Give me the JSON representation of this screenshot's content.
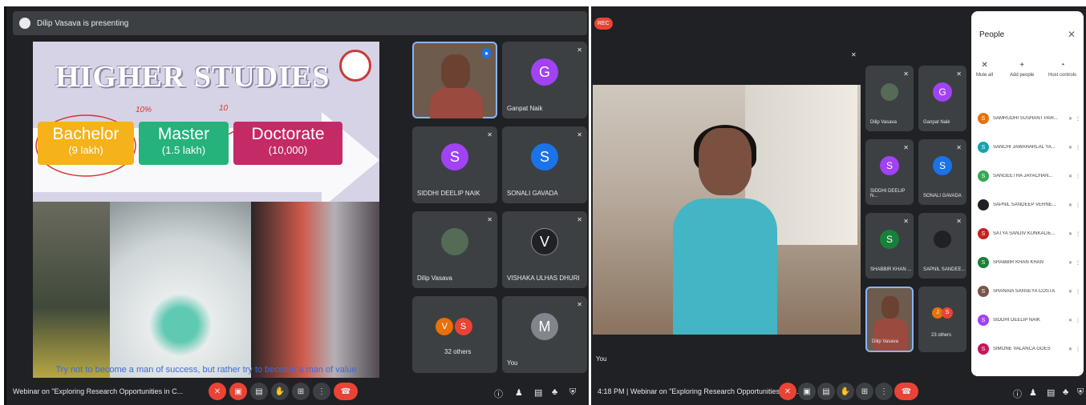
{
  "left": {
    "banner": "Dilip Vasava is presenting",
    "slide": {
      "title": "HIGHER STUDIES",
      "boxes": [
        {
          "name": "Bachelor",
          "value": "(9 lakh)"
        },
        {
          "name": "Master",
          "value": "(1.5 lakh)"
        },
        {
          "name": "Doctorate",
          "value": "(10,000)"
        }
      ],
      "annotations": [
        "10%",
        "10"
      ],
      "quote": "Try not to become a man of success, but rather try to become a man of value"
    },
    "tiles": [
      {
        "name": "Dilip Vasava",
        "kind": "video"
      },
      {
        "name": "Ganpat Naik",
        "initial": "G",
        "color": "#a142f4"
      },
      {
        "name": "SIDDHI DEELIP NAIK",
        "initial": "S",
        "color": "#a142f4"
      },
      {
        "name": "SONALI GAVADA",
        "initial": "S",
        "color": "#1a73e8"
      },
      {
        "name": "Dilip Vasava",
        "kind": "photo"
      },
      {
        "name": "VISHAKA ULHAS DHURI",
        "initial": "V",
        "color": "#202124"
      },
      {
        "name": "32 others",
        "initials": [
          "V",
          "S"
        ],
        "colors": [
          "#e8710a",
          "#ea4335"
        ]
      },
      {
        "name": "You",
        "initial": "M",
        "color": "#80868b"
      }
    ],
    "toolbar": {
      "meeting": "Webinar on \"Exploring Research Opportunities in C..."
    }
  },
  "right": {
    "rec": "REC",
    "tiles": [
      {
        "name": "Dilip Vasava"
      },
      {
        "name": "Ganpat Naik",
        "initial": "G",
        "color": "#a142f4"
      },
      {
        "name": "SIDDHI DEELIP N...",
        "initial": "S",
        "color": "#a142f4"
      },
      {
        "name": "SONALI GAVADA",
        "initial": "S",
        "color": "#1a73e8"
      },
      {
        "name": "SHABBIR KHAN ...",
        "initial": "S",
        "color": "#188038"
      },
      {
        "name": "SAPNIL SANDEE..."
      },
      {
        "name": "Dilip Vasava"
      },
      {
        "name": "23 others",
        "initials": [
          "J",
          "S"
        ],
        "colors": [
          "#e8710a",
          "#ea4335"
        ]
      }
    ],
    "you": "You",
    "toolbar": {
      "time_meeting": "4:18 PM  |  Webinar on \"Exploring Research Opportunities in C..."
    },
    "people": {
      "title": "People",
      "actions": [
        "Mute all",
        "Add people",
        "Host controls"
      ],
      "list": [
        {
          "name": "SAMRUDHI SUSHANT PAR...",
          "initial": "S",
          "color": "#e8710a"
        },
        {
          "name": "SANCHI JAWAHARLAL YA...",
          "initial": "S",
          "color": "#12a4af"
        },
        {
          "name": "SANGEETHA JAYACHAN...",
          "initial": "S",
          "color": "#34a853"
        },
        {
          "name": "SAPNIL SANDEEP VERNE...",
          "initial": "S",
          "color": "#202124"
        },
        {
          "name": "SATYA SANJIV KUNKALIE...",
          "initial": "S",
          "color": "#c5221f"
        },
        {
          "name": "SHABBIR KHAN KHAN",
          "initial": "S",
          "color": "#188038"
        },
        {
          "name": "SHANAIA SANSEYA COSTA",
          "initial": "S",
          "color": "#795548"
        },
        {
          "name": "SIDDHI DEELIP NAIK",
          "initial": "S",
          "color": "#a142f4"
        },
        {
          "name": "SIMONE VALANCA GOES",
          "initial": "S",
          "color": "#c2185b"
        }
      ]
    }
  }
}
